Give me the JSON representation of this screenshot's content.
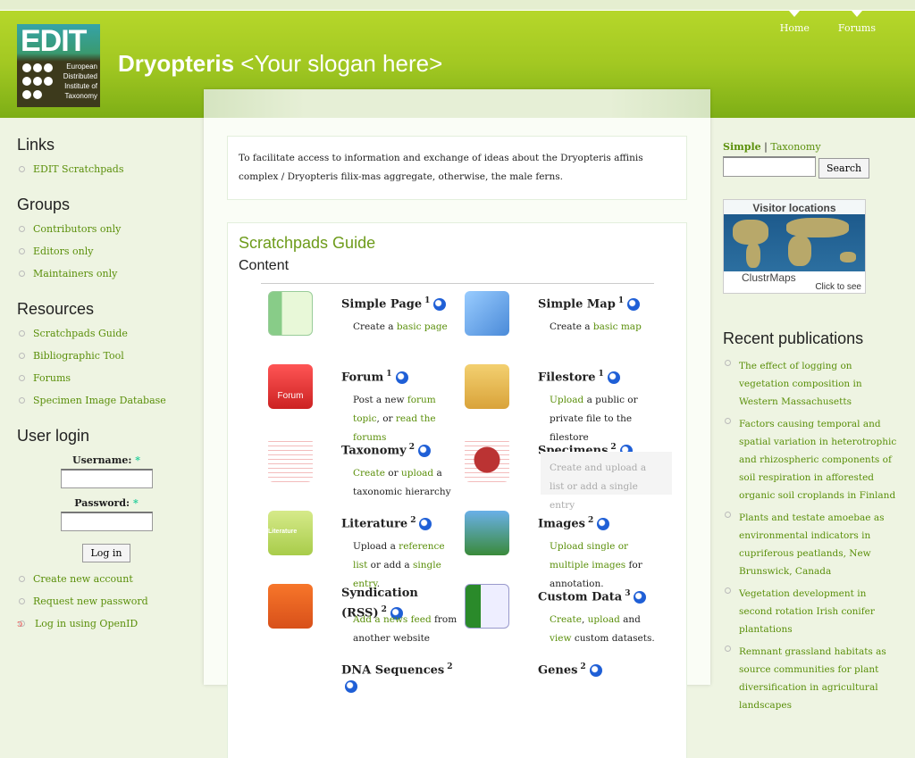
{
  "header": {
    "logo_text": "EDIT",
    "logo_subtext": [
      "European",
      "Distributed",
      "Institute of",
      "Taxonomy"
    ],
    "site_name": "Dryopteris",
    "slogan": "<Your slogan here>",
    "nav": [
      "Home",
      "Forums"
    ]
  },
  "left": {
    "links": {
      "title": "Links",
      "items": [
        "EDIT Scratchpads"
      ]
    },
    "groups": {
      "title": "Groups",
      "items": [
        "Contributors only",
        "Editors only",
        "Maintainers only"
      ]
    },
    "resources": {
      "title": "Resources",
      "items": [
        "Scratchpads Guide",
        "Bibliographic Tool",
        "Forums",
        "Specimen Image Database"
      ]
    },
    "login": {
      "title": "User login",
      "username_label": "Username:",
      "password_label": "Password:",
      "required": "*",
      "username_value": "",
      "password_value": "",
      "button": "Log in",
      "links": [
        "Create new account",
        "Request new password",
        "Log in using OpenID"
      ]
    }
  },
  "main": {
    "intro": "To facilitate access to information and exchange of ideas about the Dryopteris affinis complex / Dryopteris filix-mas aggregate, otherwise, the male ferns.",
    "guide_title": "Scratchpads Guide",
    "content_title": "Content",
    "items": [
      {
        "title": "Simple Page",
        "sup": "1",
        "icon": "document-icon",
        "desc": [
          [
            "Create a ",
            ""
          ],
          [
            "basic page",
            "l"
          ]
        ]
      },
      {
        "title": "Simple Map",
        "sup": "1",
        "icon": "map-icon",
        "desc": [
          [
            "Create a ",
            ""
          ],
          [
            "basic map",
            "l"
          ]
        ]
      },
      {
        "title": "Forum",
        "sup": "1",
        "icon": "forum-icon",
        "icon_label": "Forum",
        "desc": [
          [
            "Post a new ",
            ""
          ],
          [
            "forum topic",
            "l"
          ],
          [
            ", or ",
            ""
          ],
          [
            "read the forums",
            "l"
          ]
        ]
      },
      {
        "title": "Filestore",
        "sup": "1",
        "icon": "boxes-icon",
        "desc": [
          [
            "Upload",
            "l"
          ],
          [
            " a public or private file to the filestore",
            ""
          ]
        ]
      },
      {
        "title": "Taxonomy",
        "sup": "2",
        "icon": "tree-icon",
        "desc": [
          [
            "Create",
            "l"
          ],
          [
            " or ",
            ""
          ],
          [
            "upload",
            "l"
          ],
          [
            " a taxonomic hierarchy",
            ""
          ]
        ]
      },
      {
        "title": "Specimens",
        "sup": "2",
        "icon": "bug-icon",
        "disabled": true,
        "desc": [
          [
            "Create and upload a list or add a single entry",
            ""
          ]
        ]
      },
      {
        "title": "Literature",
        "sup": "2",
        "icon": "literature-icon",
        "icon_label": "Literature",
        "desc": [
          [
            "Upload a ",
            ""
          ],
          [
            "reference list",
            "l"
          ],
          [
            " or add a ",
            ""
          ],
          [
            "single entry",
            "l"
          ],
          [
            ".",
            ""
          ]
        ]
      },
      {
        "title": "Images",
        "sup": "2",
        "icon": "image-icon",
        "desc": [
          [
            "Upload single or multiple images",
            "l"
          ],
          [
            " for annotation.",
            ""
          ]
        ]
      },
      {
        "title": "Syndication (RSS)",
        "sup": "2",
        "icon": "rss-icon",
        "desc": [
          [
            "Add a news feed",
            "l"
          ],
          [
            " from another website",
            ""
          ]
        ]
      },
      {
        "title": "Custom Data",
        "sup": "3",
        "icon": "spreadsheet-icon",
        "desc": [
          [
            "Create",
            "l"
          ],
          [
            ", ",
            ""
          ],
          [
            "upload",
            "l"
          ],
          [
            " and ",
            ""
          ],
          [
            "view",
            "l"
          ],
          [
            " custom datasets.",
            ""
          ]
        ]
      },
      {
        "title": "DNA Sequences",
        "sup": "2",
        "icon": "dna-icon",
        "desc": []
      },
      {
        "title": "Genes",
        "sup": "2",
        "icon": "genes-icon",
        "desc": []
      }
    ]
  },
  "right": {
    "search_tabs": [
      "Simple",
      "Taxonomy"
    ],
    "search_value": "",
    "search_button": "Search",
    "map": {
      "title": "Visitor locations",
      "brand": "ClustrMaps",
      "cta": "Click to see"
    },
    "publications": {
      "title": "Recent publications",
      "items": [
        "The effect of logging on vegetation composition in Western Massachusetts",
        "Factors causing temporal and spatial variation in heterotrophic and rhizospheric components of soil respiration in afforested organic soil croplands in Finland",
        "Plants and testate amoebae as environmental indicators in cupriferous peatlands, New Brunswick, Canada",
        "Vegetation development in second rotation Irish conifer plantations",
        "Remnant grassland habitats as source communities for plant diversification in agricultural landscapes"
      ]
    }
  },
  "colors": {
    "header_green": "#a2c822",
    "link_green": "#5a8f0a",
    "search_icon": "#1f5fd6"
  }
}
